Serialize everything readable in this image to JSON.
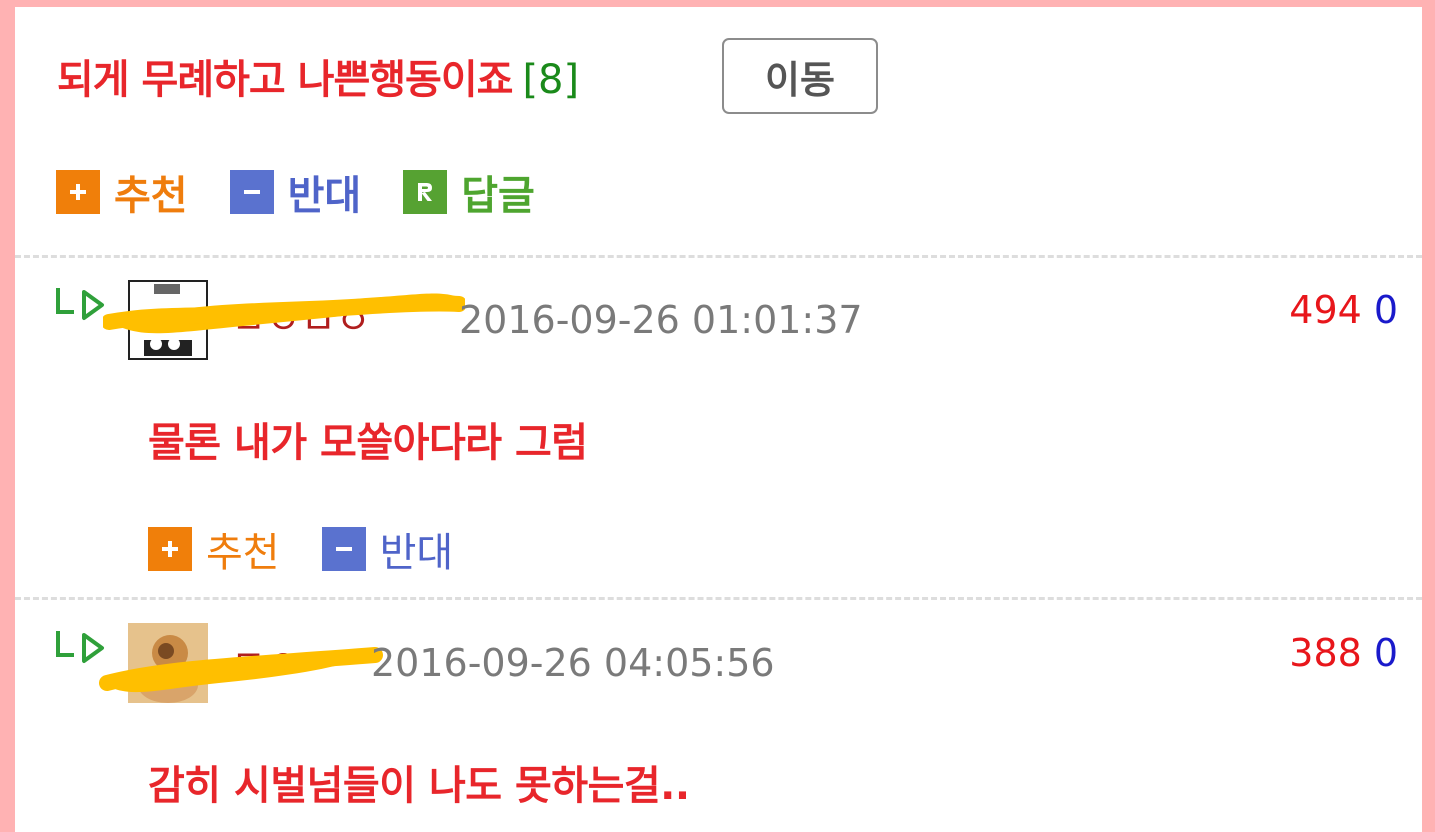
{
  "main_comment": {
    "title": "되게 무례하고 나쁜행동이죠",
    "reply_count": "[8]",
    "move_button_label": "이동",
    "actions": {
      "recommend_label": "추천",
      "oppose_label": "반대",
      "reply_label": "답글"
    }
  },
  "replies": [
    {
      "username": "ㅁㅇㅁㅇ",
      "timestamp": "2016-09-26 01:01:37",
      "upvotes": "494",
      "downvotes": "0",
      "text": "물론 내가 모쏠아다라 그럼",
      "recommend_label": "추천",
      "oppose_label": "반대"
    },
    {
      "username": "ㅁㅇ",
      "timestamp": "2016-09-26 04:05:56",
      "upvotes": "388",
      "downvotes": "0",
      "text": "감히 시벌넘들이 나도 못하는걸.."
    }
  ],
  "colors": {
    "page_background": "#ffb2b3",
    "comment_text": "#e8262b",
    "reply_count": "#1a8a1a",
    "recommend": "#ef7d0d",
    "oppose": "#4f64c9",
    "reply": "#4ea52f",
    "redaction": "#ffbf00"
  },
  "icons": {
    "recommend": "plus-square-icon",
    "oppose": "minus-square-icon",
    "reply": "r-square-icon",
    "reply_indicator": "reply-arrow-icon"
  }
}
